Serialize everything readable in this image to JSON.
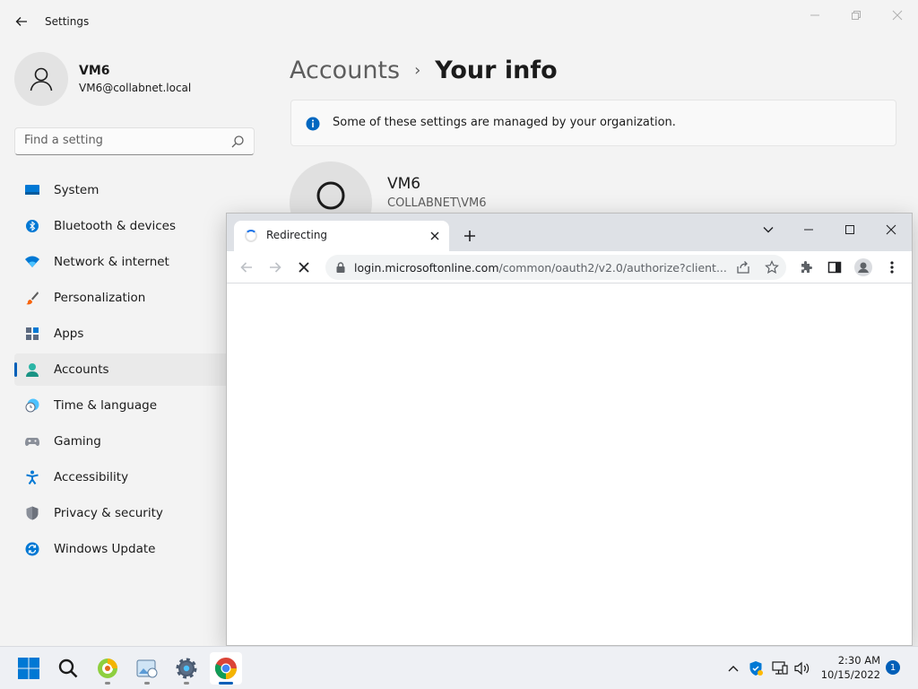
{
  "settings": {
    "title": "Settings",
    "user": {
      "name": "VM6",
      "email": "VM6@collabnet.local"
    },
    "search": {
      "placeholder": "Find a setting"
    },
    "nav": [
      {
        "label": "System",
        "icon": "monitor-icon",
        "active": false
      },
      {
        "label": "Bluetooth & devices",
        "icon": "bluetooth-icon",
        "active": false
      },
      {
        "label": "Network & internet",
        "icon": "wifi-icon",
        "active": false
      },
      {
        "label": "Personalization",
        "icon": "paintbrush-icon",
        "active": false
      },
      {
        "label": "Apps",
        "icon": "apps-icon",
        "active": false
      },
      {
        "label": "Accounts",
        "icon": "accounts-icon",
        "active": true
      },
      {
        "label": "Time & language",
        "icon": "clock-globe-icon",
        "active": false
      },
      {
        "label": "Gaming",
        "icon": "gamepad-icon",
        "active": false
      },
      {
        "label": "Accessibility",
        "icon": "accessibility-icon",
        "active": false
      },
      {
        "label": "Privacy & security",
        "icon": "shield-icon",
        "active": false
      },
      {
        "label": "Windows Update",
        "icon": "update-icon",
        "active": false
      }
    ],
    "breadcrumb": {
      "parent": "Accounts",
      "separator": "›",
      "current": "Your info"
    },
    "info_bar": {
      "text": "Some of these settings are managed by your organization."
    },
    "profile": {
      "name": "VM6",
      "domain": "COLLABNET\\VM6"
    }
  },
  "browser": {
    "tab": {
      "title": "Redirecting"
    },
    "address": {
      "host": "login.microsoftonline.com",
      "path": "/common/oauth2/v2.0/authorize?client..."
    }
  },
  "taskbar": {
    "apps": [
      "start-icon",
      "search-icon",
      "app-icon",
      "photos-icon",
      "settings-icon",
      "chrome-icon"
    ],
    "clock": {
      "time": "2:30 AM",
      "date": "10/15/2022"
    },
    "notifications": "1"
  },
  "colors": {
    "accent": "#005fb8",
    "info": "#0067c0",
    "chrome_tab_strip": "#dee1e6"
  }
}
